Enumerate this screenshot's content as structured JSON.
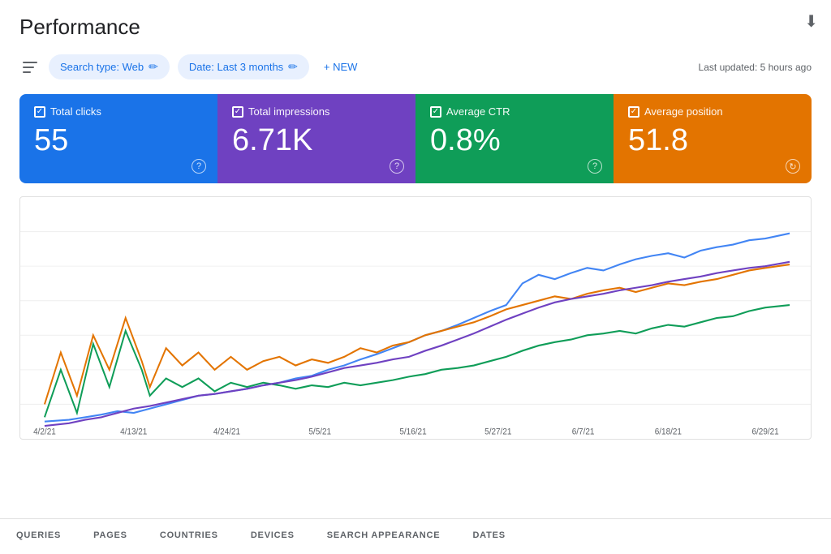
{
  "header": {
    "title": "Performance",
    "download_icon": "⬇"
  },
  "toolbar": {
    "filter_icon": "≡",
    "chips": [
      {
        "label": "Search type: Web",
        "icon": "✏"
      },
      {
        "label": "Date: Last 3 months",
        "icon": "✏"
      }
    ],
    "new_button_label": "+ NEW",
    "last_updated": "Last updated: 5 hours ago"
  },
  "metrics": [
    {
      "id": "total-clicks",
      "label": "Total clicks",
      "value": "55",
      "color": "blue"
    },
    {
      "id": "total-impressions",
      "label": "Total impressions",
      "value": "6.71K",
      "color": "purple"
    },
    {
      "id": "average-ctr",
      "label": "Average CTR",
      "value": "0.8%",
      "color": "teal"
    },
    {
      "id": "average-position",
      "label": "Average position",
      "value": "51.8",
      "color": "orange"
    }
  ],
  "chart": {
    "x_labels": [
      "4/2/21",
      "4/13/21",
      "4/24/21",
      "5/5/21",
      "5/16/21",
      "5/27/21",
      "6/7/21",
      "6/18/21",
      "6/29/21"
    ],
    "lines": {
      "blue": "impressions",
      "orange": "clicks",
      "teal": "ctr",
      "purple": "position"
    }
  },
  "bottom_tabs": [
    {
      "label": "QUERIES",
      "active": false
    },
    {
      "label": "PAGES",
      "active": false
    },
    {
      "label": "COUNTRIES",
      "active": false
    },
    {
      "label": "DEVICES",
      "active": false
    },
    {
      "label": "SEARCH APPEARANCE",
      "active": false
    },
    {
      "label": "DATES",
      "active": false
    }
  ]
}
